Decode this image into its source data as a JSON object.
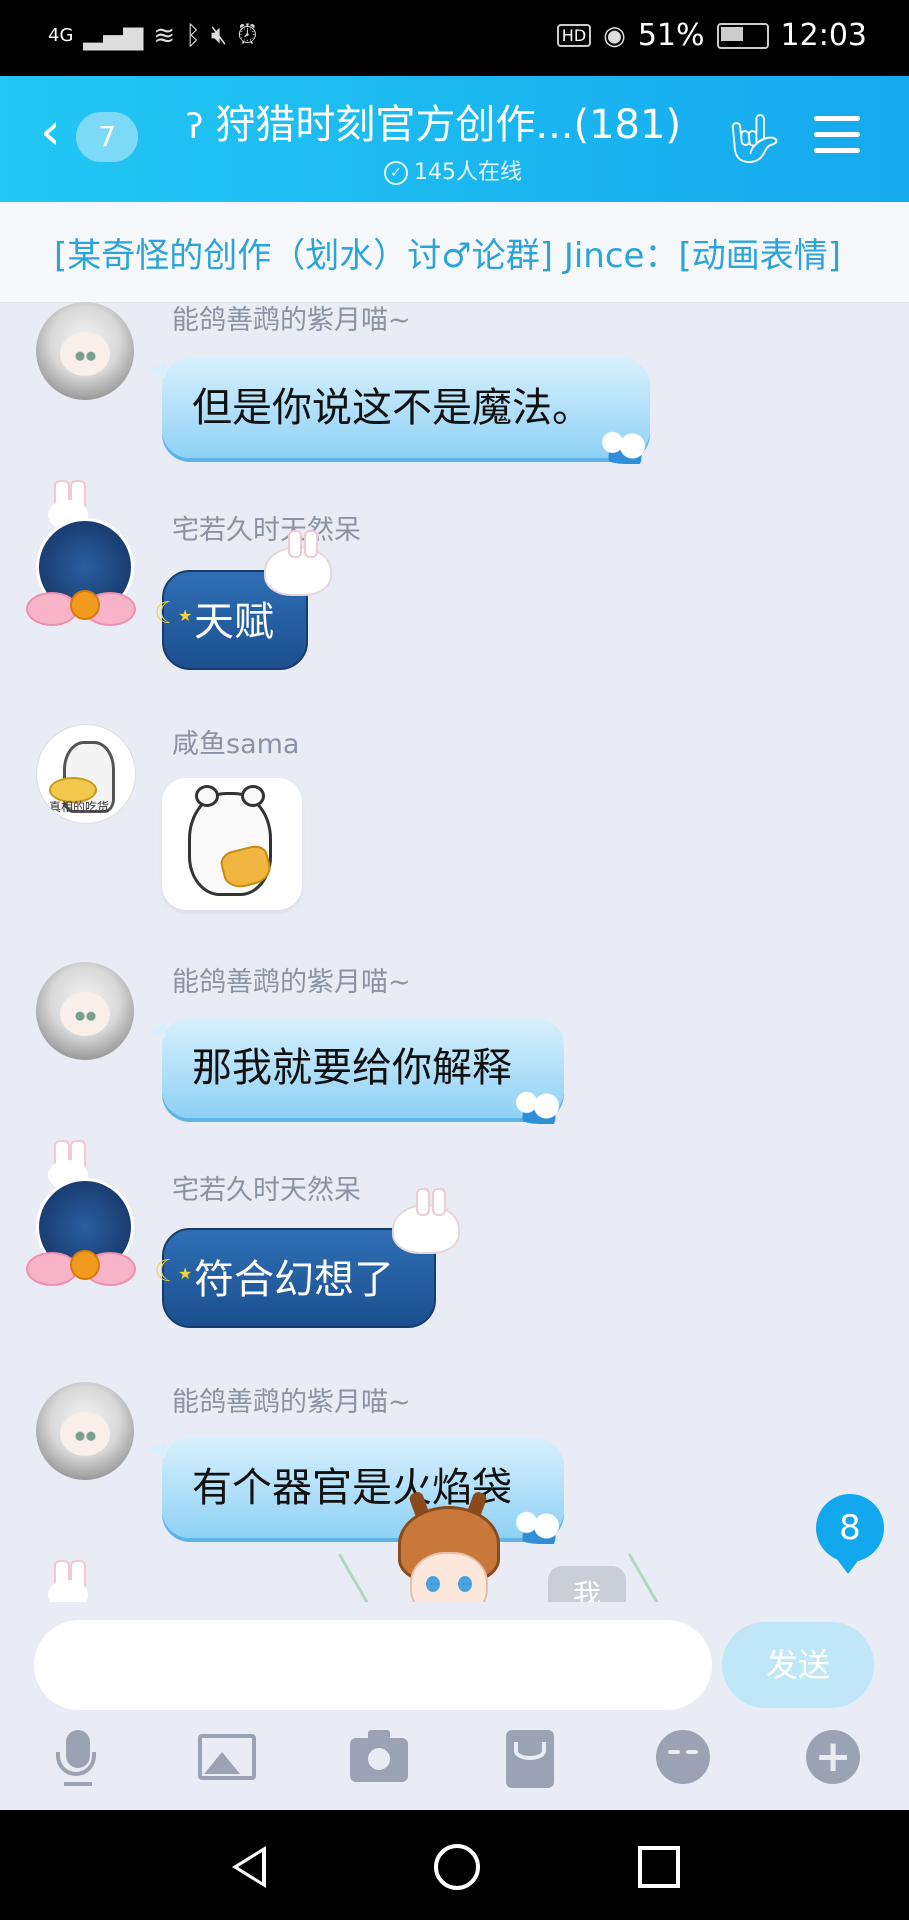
{
  "status_bar": {
    "net_type": "4G",
    "hd": "HD",
    "battery": "51%",
    "time": "12:03"
  },
  "header": {
    "unread": "7",
    "title": "狩猎时刻官方创作...(181)",
    "online": "145人在线"
  },
  "announcement": "[某奇怪的创作（划水）讨♂论群] Jince：[动画表情]",
  "messages": [
    {
      "sender": "能鸽善鹉的紫月喵~",
      "text": "但是你说这不是魔法。",
      "style": "light"
    },
    {
      "sender": "宅若久时天然呆",
      "text": "天赋",
      "style": "dark"
    },
    {
      "sender": "咸鱼sama",
      "text": "",
      "style": "sticker"
    },
    {
      "sender": "能鸽善鹉的紫月喵~",
      "text": "那我就要给你解释",
      "style": "light"
    },
    {
      "sender": "宅若久时天然呆",
      "text": "符合幻想了",
      "style": "dark"
    },
    {
      "sender": "能鸽善鹉的紫月喵~",
      "text": "有个器官是火焰袋",
      "style": "light"
    }
  ],
  "avatar_caption": "真相的吃货",
  "overlay": {
    "me_tag": "我",
    "new_count": "8"
  },
  "composer": {
    "value": "",
    "send_label": "发送"
  },
  "toolbar_icons": [
    "mic-icon",
    "image-icon",
    "camera-icon",
    "red-packet-icon",
    "emoji-icon",
    "plus-icon"
  ],
  "colors": {
    "header_blue": "#15a9ee",
    "bubble_light": "#8ed1f5",
    "bubble_dark": "#1c4f8f",
    "chat_bg": "#e9ecf5"
  }
}
